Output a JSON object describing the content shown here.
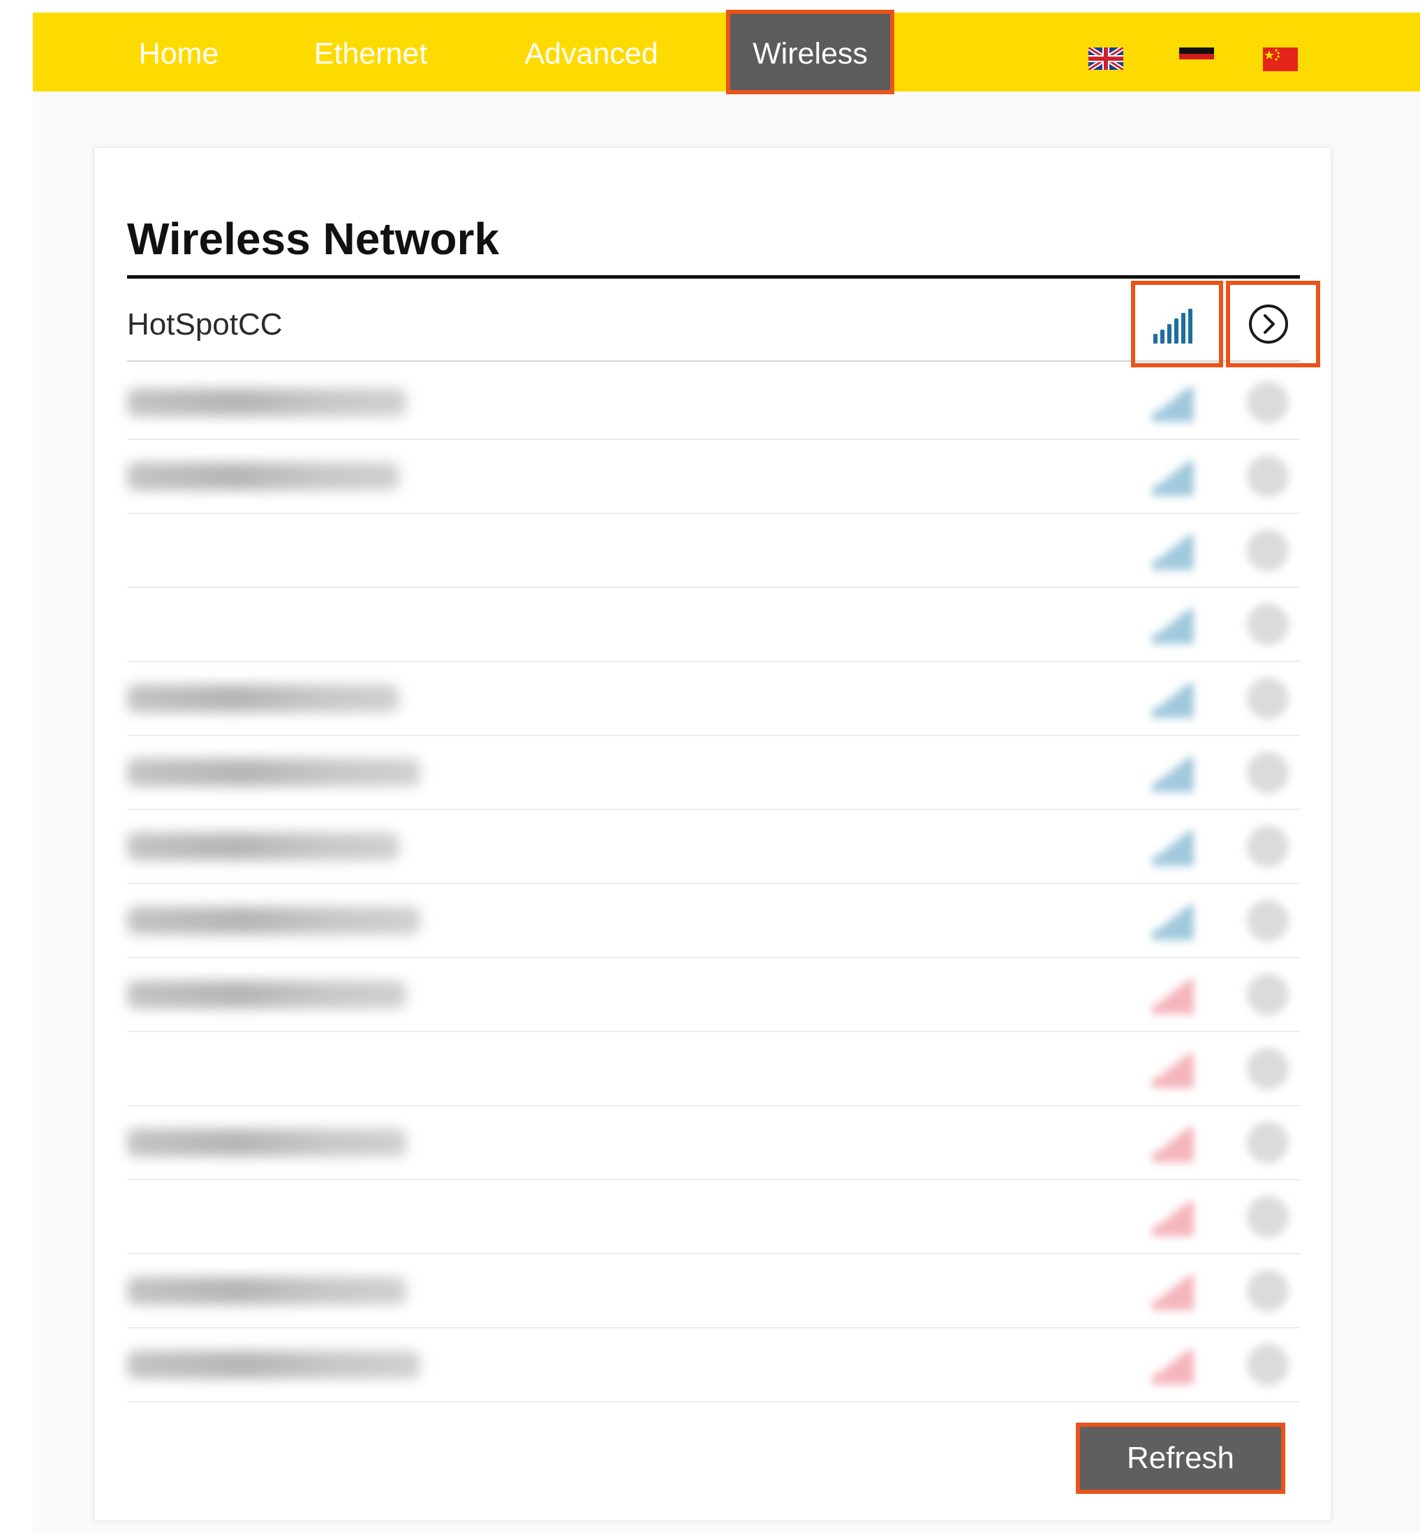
{
  "nav": {
    "items": [
      {
        "label": "Home",
        "active": false
      },
      {
        "label": "Ethernet",
        "active": false
      },
      {
        "label": "Advanced",
        "active": false
      },
      {
        "label": "Wireless",
        "active": true
      }
    ],
    "languages": [
      {
        "code": "en",
        "icon": "uk-flag-icon"
      },
      {
        "code": "de",
        "icon": "german-flag-icon"
      },
      {
        "code": "zh",
        "icon": "china-flag-icon"
      }
    ],
    "bar_color": "#fedb00",
    "active_color": "#5c5c5c",
    "highlight_color": "#e8541a"
  },
  "wireless": {
    "title": "Wireless Network",
    "networks": [
      {
        "ssid": "HotSpotCC",
        "signal_color": "#1d6f9e",
        "blurred": false
      },
      {
        "ssid": "",
        "signal_color": "#2f86b3",
        "blurred": true
      },
      {
        "ssid": "",
        "signal_color": "#2f86b3",
        "blurred": true
      },
      {
        "ssid": "",
        "signal_color": "#2f86b3",
        "blurred": true
      },
      {
        "ssid": "",
        "signal_color": "#2f86b3",
        "blurred": true
      },
      {
        "ssid": "",
        "signal_color": "#2f86b3",
        "blurred": true
      },
      {
        "ssid": "",
        "signal_color": "#2f86b3",
        "blurred": true
      },
      {
        "ssid": "",
        "signal_color": "#2f86b3",
        "blurred": true
      },
      {
        "ssid": "",
        "signal_color": "#2f86b3",
        "blurred": true
      },
      {
        "ssid": "",
        "signal_color": "#e85a6a",
        "blurred": true
      },
      {
        "ssid": "",
        "signal_color": "#e85a6a",
        "blurred": true
      },
      {
        "ssid": "",
        "signal_color": "#e85a6a",
        "blurred": true
      },
      {
        "ssid": "",
        "signal_color": "#e85a6a",
        "blurred": true
      },
      {
        "ssid": "",
        "signal_color": "#e85a6a",
        "blurred": true
      },
      {
        "ssid": "",
        "signal_color": "#e85a6a",
        "blurred": true
      }
    ],
    "refresh_label": "Refresh"
  }
}
